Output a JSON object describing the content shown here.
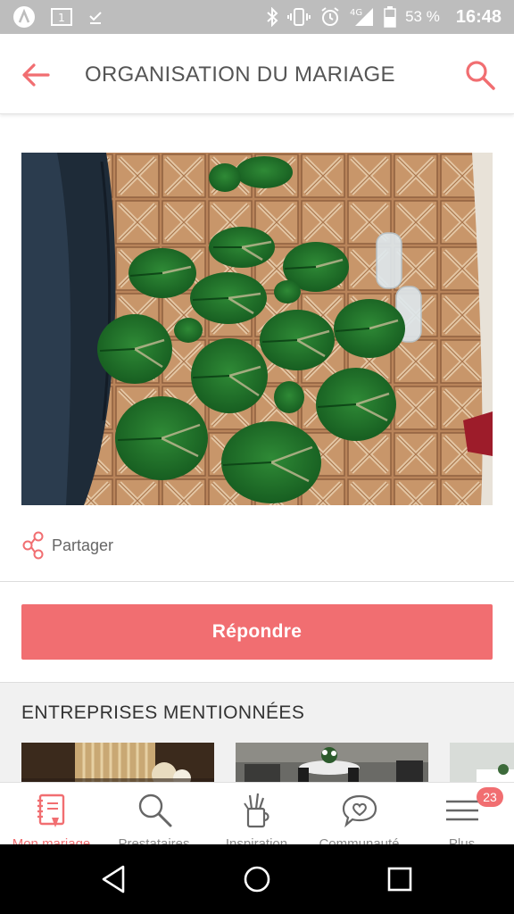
{
  "status_bar": {
    "battery": "53 %",
    "time": "16:48",
    "network": "4G",
    "icons": [
      "app-notification-icon",
      "sim-card-icon",
      "download-done-icon",
      "bluetooth-icon",
      "vibrate-icon",
      "alarm-icon",
      "signal-icon",
      "battery-icon"
    ]
  },
  "header": {
    "title": "ORGANISATION DU MARIAGE",
    "back_icon": "back-arrow-icon",
    "search_icon": "search-icon"
  },
  "post": {
    "photo_icon": "post-photo",
    "share_label": "Partager"
  },
  "reply_button": "Répondre",
  "companies": {
    "title": "ENTREPRISES MENTIONNÉES"
  },
  "bottom_nav": {
    "items": [
      {
        "label": "Mon mariage",
        "icon": "notebook-icon",
        "active": true
      },
      {
        "label": "Prestataires",
        "icon": "search-icon",
        "active": false
      },
      {
        "label": "Inspiration",
        "icon": "pencil-cup-icon",
        "active": false
      },
      {
        "label": "Communauté",
        "icon": "chat-heart-icon",
        "active": false
      },
      {
        "label": "Plus",
        "icon": "menu-icon",
        "active": false,
        "badge": "23"
      }
    ]
  },
  "colors": {
    "accent": "#f16e71",
    "status_bar": "#bdbdbd",
    "section_bg": "#f1f1f1"
  }
}
